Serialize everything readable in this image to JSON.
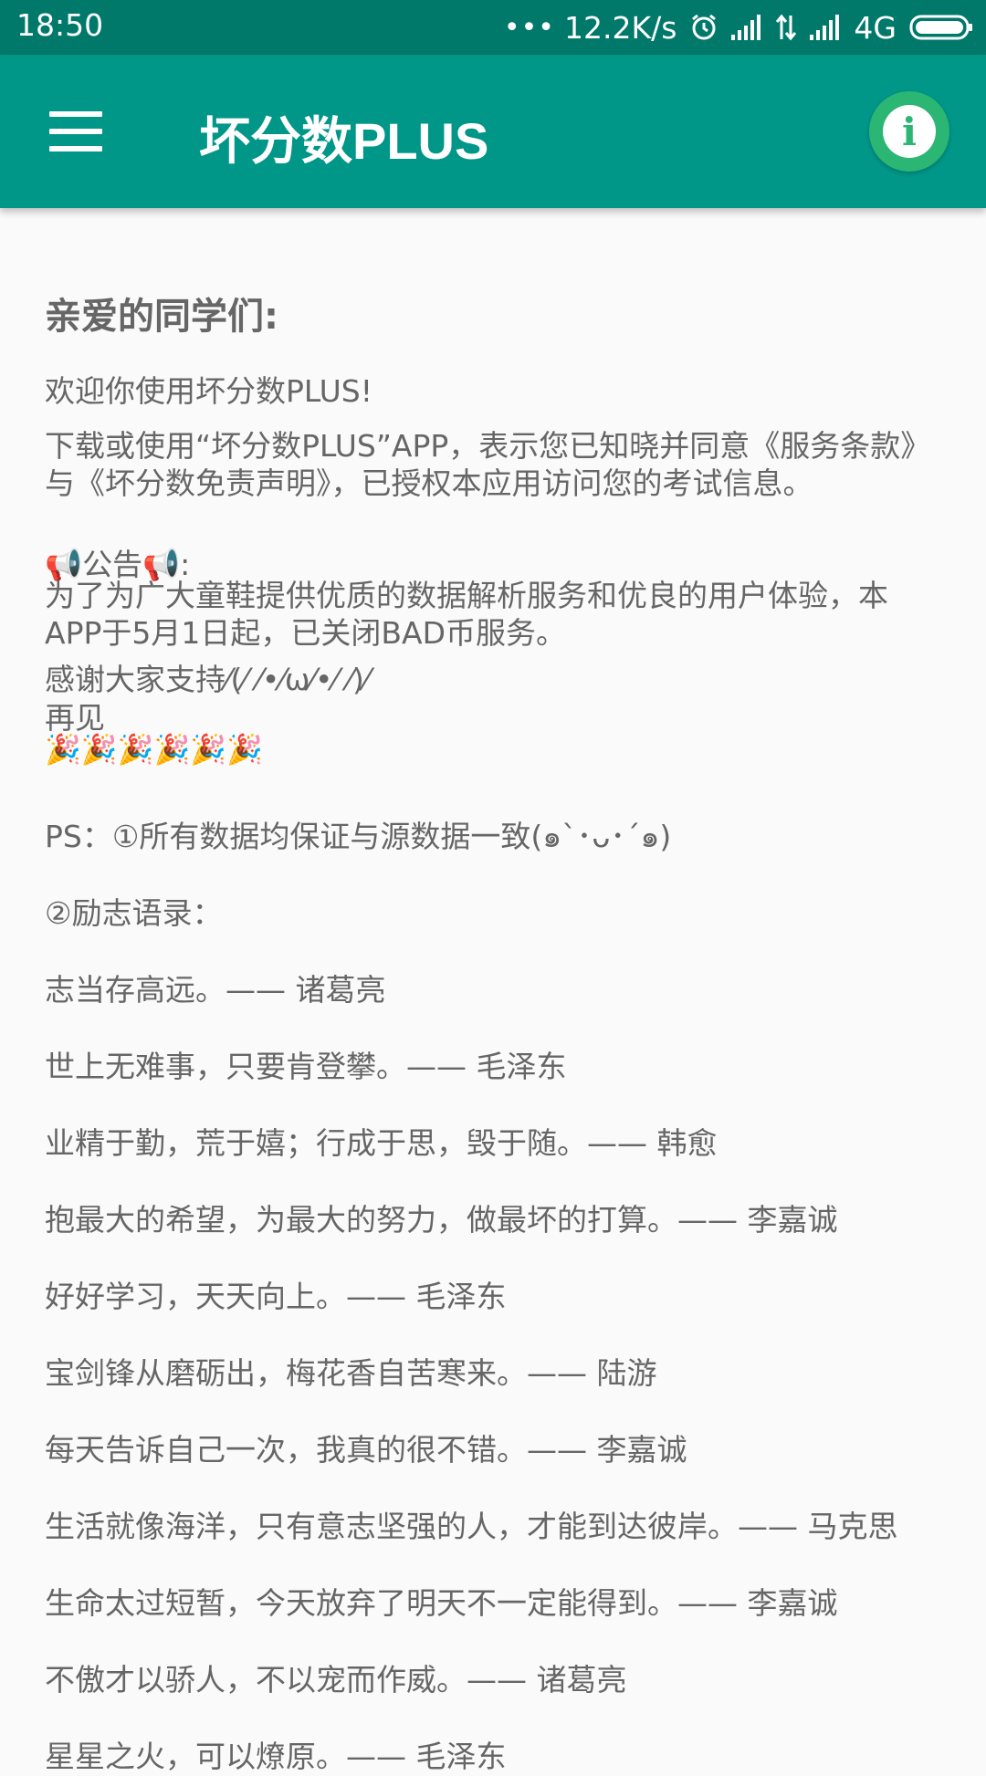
{
  "status_bar": {
    "time": "18:50",
    "dots": "•••",
    "speed": "12.2K/s",
    "network": "4G"
  },
  "app_bar": {
    "title": "坏分数PLUS",
    "info_glyph": "i"
  },
  "content": {
    "greeting": "亲爱的同学们:",
    "welcome": "欢迎你使用坏分数PLUS!",
    "terms": "下载或使用“坏分数PLUS”APP，表示您已知晓并同意《服务条款》与《坏分数免责声明》，已授权本应用访问您的考试信息。",
    "announce_title": "📢公告📢:",
    "announce_body_1": "为了为广大童鞋提供优质的数据解析服务和优良的用户体验，本APP于5月1日起，已关闭BAD币服务。",
    "announce_body_2": "感谢大家支持⁄(⁄ ⁄•⁄ω⁄•⁄ ⁄)⁄",
    "announce_body_3": "再见",
    "celebration": "🎉🎉🎉🎉🎉🎉",
    "ps_1": "PS：①所有数据均保证与源数据一致(๑`･ᴗ･´๑)",
    "ps_2": "②励志语录：",
    "quotes": [
      "志当存高远。—— 诸葛亮",
      "世上无难事，只要肯登攀。—— 毛泽东",
      "业精于勤，荒于嬉；行成于思，毁于随。—— 韩愈",
      "抱最大的希望，为最大的努力，做最坏的打算。—— 李嘉诚",
      "好好学习，天天向上。—— 毛泽东",
      "宝剑锋从磨砺出，梅花香自苦寒来。—— 陆游",
      "每天告诉自己一次，我真的很不错。—— 李嘉诚",
      "生活就像海洋，只有意志坚强的人，才能到达彼岸。—— 马克思",
      "生命太过短暂，今天放弃了明天不一定能得到。—— 李嘉诚",
      "不傲才以骄人，不以宠而作威。—— 诸葛亮",
      "星星之火，可以燎原。—— 毛泽东"
    ]
  },
  "colors": {
    "status_bar": "#00796b",
    "app_bar": "#009688",
    "info_button": "#2bb673",
    "background": "#fafafa",
    "text": "#666666"
  }
}
